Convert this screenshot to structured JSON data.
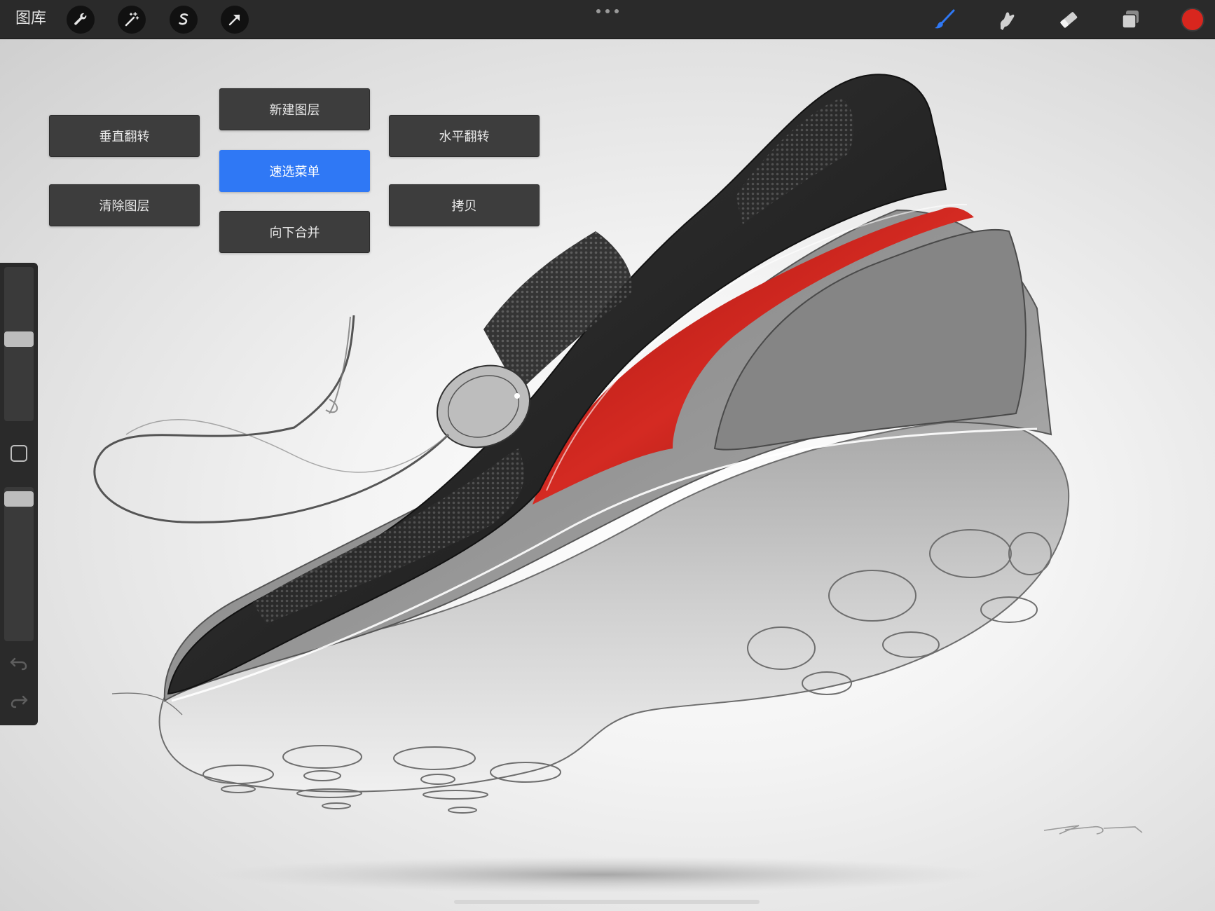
{
  "toolbar": {
    "gallery_label": "图库",
    "left_tools": [
      {
        "icon": "wrench-icon"
      },
      {
        "icon": "magic-wand-icon"
      },
      {
        "icon": "selection-s-icon"
      },
      {
        "icon": "arrow-cursor-icon"
      }
    ],
    "right_tools": [
      {
        "icon": "brush-icon",
        "active": true
      },
      {
        "icon": "smudge-icon"
      },
      {
        "icon": "eraser-icon"
      },
      {
        "icon": "layers-icon"
      }
    ],
    "current_color": "#d8261e",
    "accent_color": "#2f78f5"
  },
  "quick_menu": {
    "buttons": [
      {
        "label": "新建图层",
        "active": false
      },
      {
        "label": "垂直翻转",
        "active": false
      },
      {
        "label": "速选菜单",
        "active": true
      },
      {
        "label": "水平翻转",
        "active": false
      },
      {
        "label": "清除图层",
        "active": false
      },
      {
        "label": "拷贝",
        "active": false
      },
      {
        "label": "向下合并",
        "active": false
      }
    ]
  },
  "sidebar": {
    "brush_size_level": 0.5,
    "opacity_level": 0.95,
    "modify_icon": "square-modify-icon",
    "undo_icon": "undo-icon",
    "redo_icon": "redo-icon"
  }
}
